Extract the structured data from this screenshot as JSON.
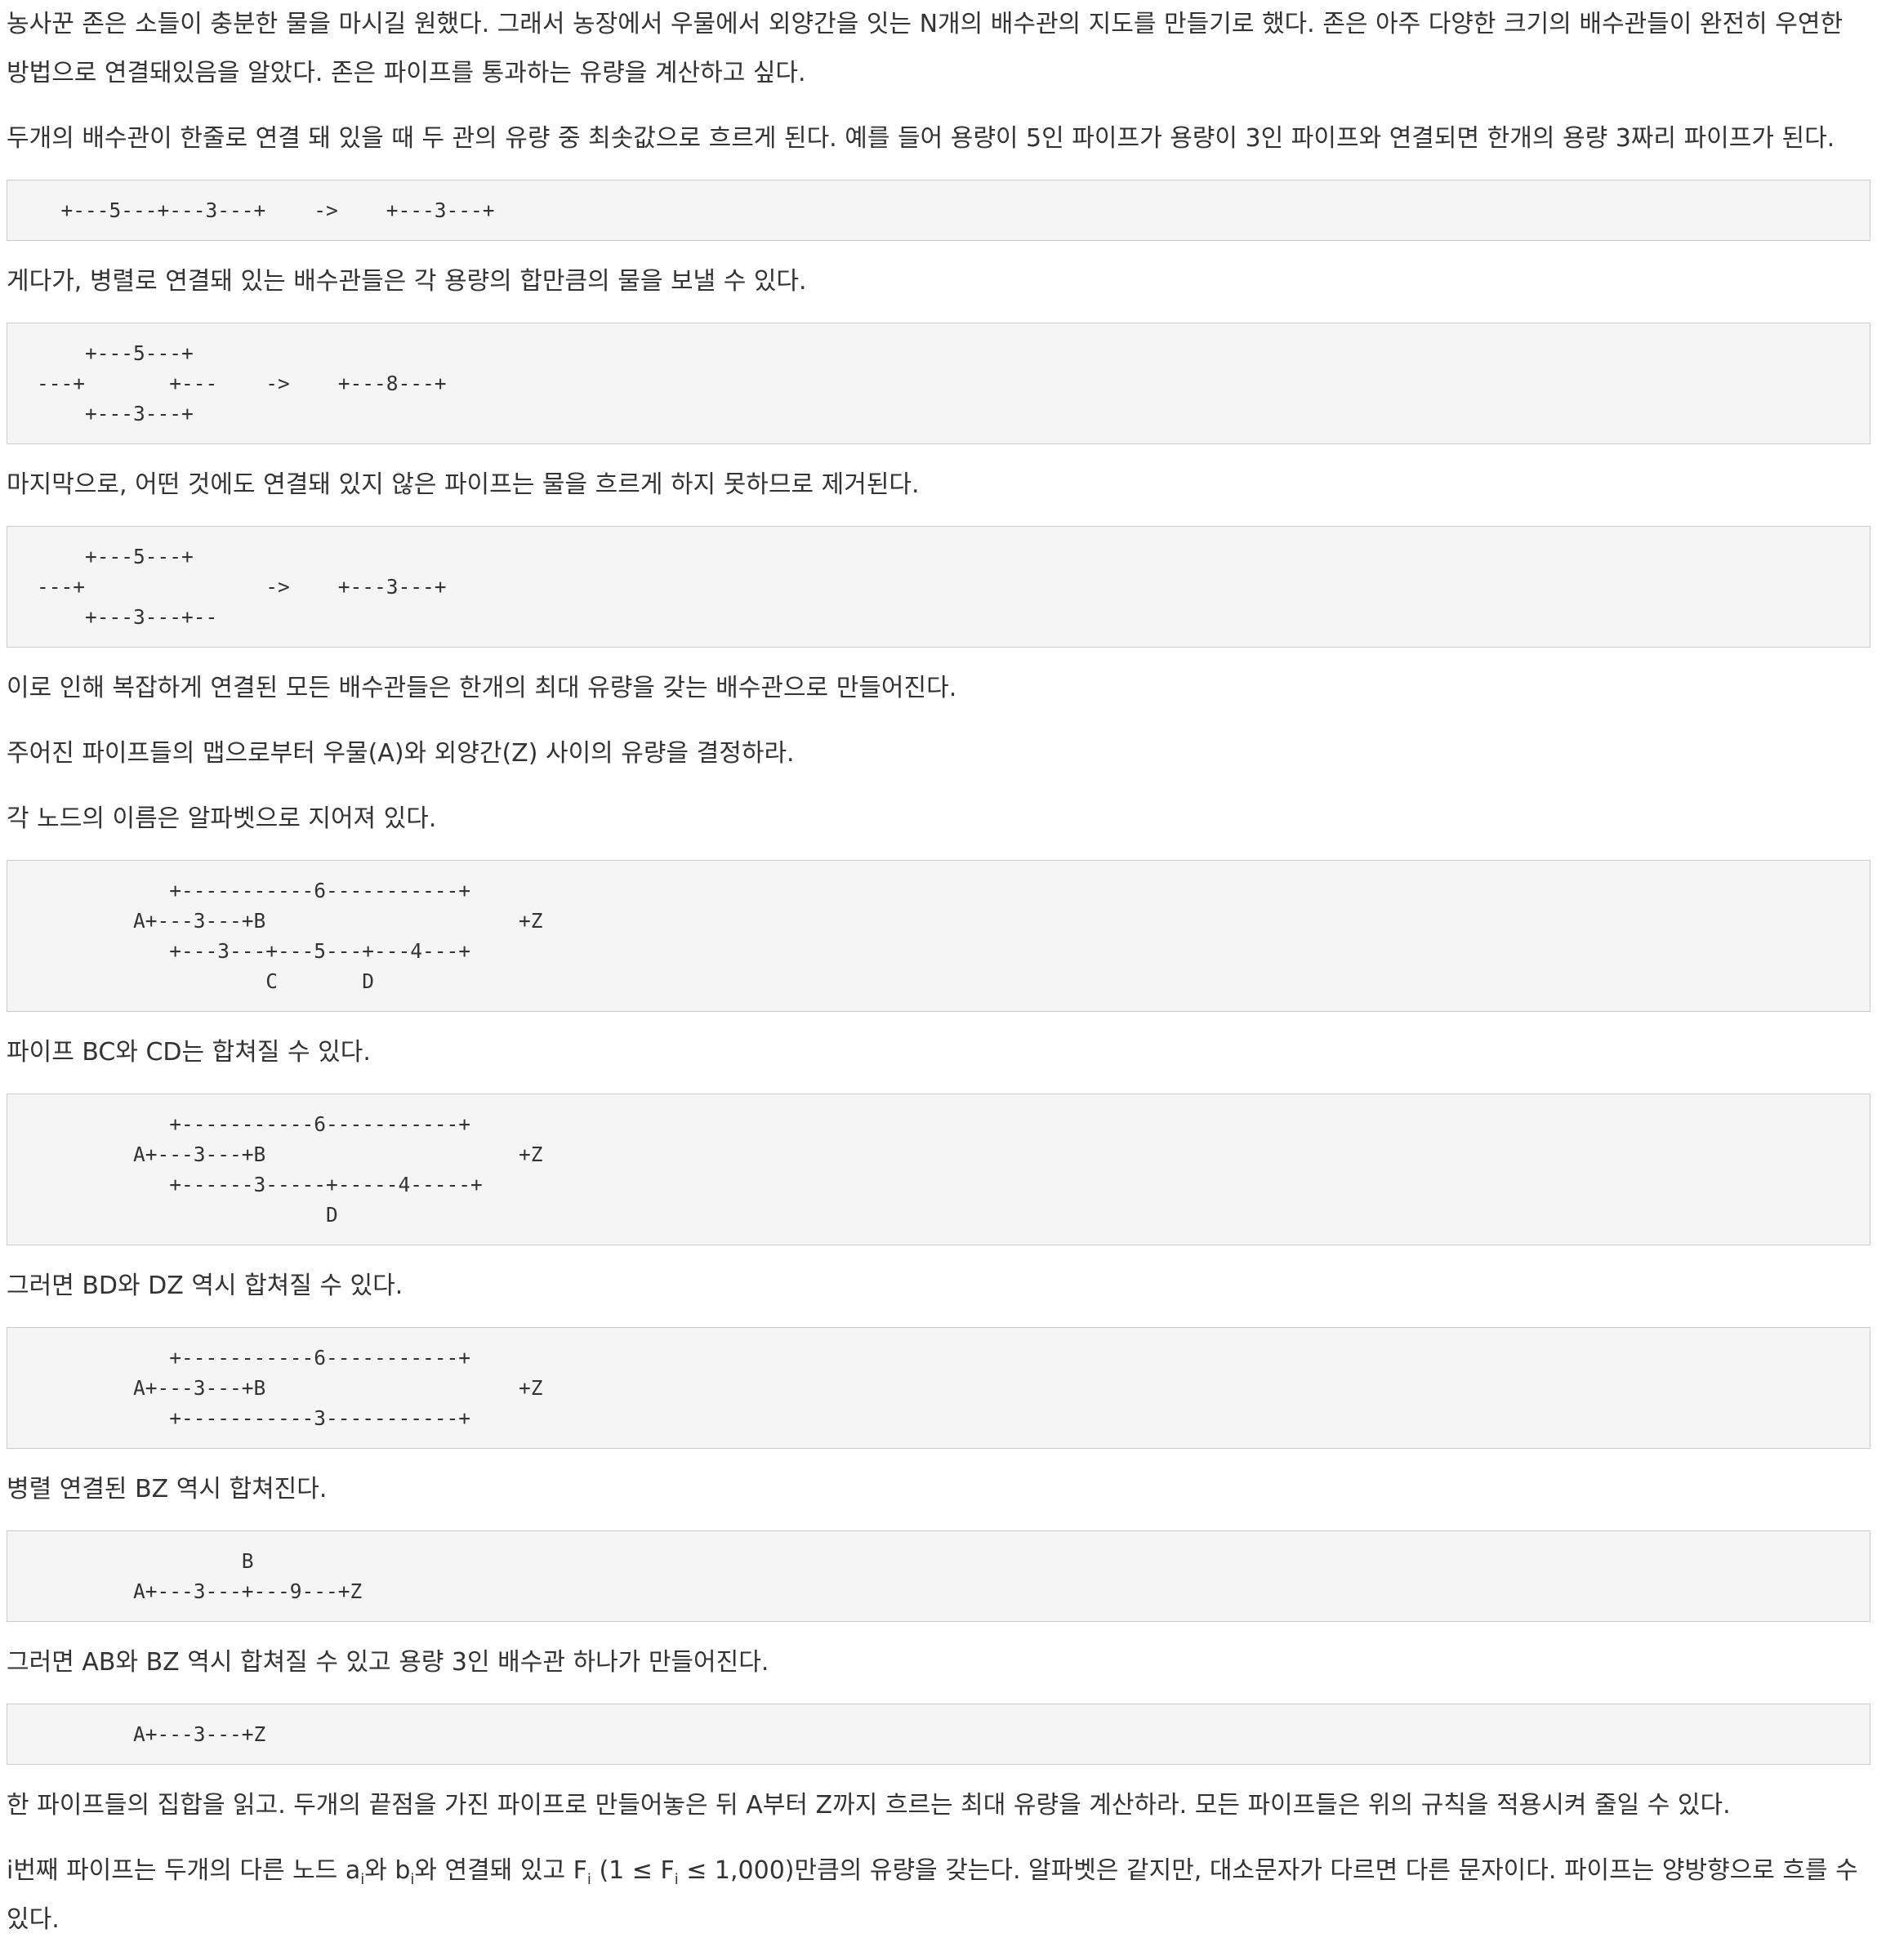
{
  "paragraphs": [
    "농사꾼 존은 소들이 충분한 물을 마시길 원했다. 그래서 농장에서 우물에서 외양간을 잇는 N개의 배수관의 지도를 만들기로 했다. 존은 아주 다양한 크기의 배수관들이 완전히 우연한 방법으로 연결돼있음을 알았다. 존은 파이프를 통과하는 유량을 계산하고 싶다.",
    "두개의 배수관이 한줄로 연결 돼 있을 때 두 관의 유량 중 최솟값으로 흐르게 된다. 예를 들어 용량이 5인 파이프가 용량이 3인 파이프와 연결되면 한개의 용량 3짜리 파이프가 된다.",
    "게다가, 병렬로 연결돼 있는 배수관들은 각 용량의 합만큼의 물을 보낼 수 있다.",
    "마지막으로, 어떤 것에도 연결돼 있지 않은 파이프는 물을 흐르게 하지 못하므로 제거된다.",
    "이로 인해 복잡하게 연결된 모든 배수관들은 한개의 최대 유량을 갖는 배수관으로 만들어진다.",
    "주어진 파이프들의 맵으로부터 우물(A)와 외양간(Z) 사이의 유량을 결정하라.",
    "각 노드의 이름은 알파벳으로 지어져 있다.",
    "파이프 BC와 CD는 합쳐질 수 있다.",
    "그러면 BD와 DZ 역시 합쳐질 수 있다.",
    "병렬 연결된 BZ 역시 합쳐진다.",
    "그러면 AB와 BZ 역시 합쳐질 수 있고 용량 3인 배수관 하나가 만들어진다.",
    "한 파이프들의 집합을 읽고. 두개의 끝점을 가진 파이프로 만들어놓은 뒤 A부터 Z까지 흐르는 최대 유량을 계산하라. 모든 파이프들은 위의 규칙을 적용시켜 줄일 수 있다."
  ],
  "last_paragraph": {
    "t1": "i번째 파이프는 두개의 다른 노드 a",
    "s1": "i",
    "t2": "와 b",
    "s2": "i",
    "t3": "와 연결돼 있고 F",
    "s3": "i",
    "t4": " (1 ≤ F",
    "s4": "i",
    "t5": " ≤ 1,000)만큼의 유량을 갖는다. 알파벳은 같지만, 대소문자가 다르면 다른 문자이다. 파이프는 양방향으로 흐를 수 있다."
  },
  "code_blocks": [
    "  +---5---+---3---+    ->    +---3---+",
    "    +---5---+\n---+       +---    ->    +---8---+\n    +---3---+",
    "    +---5---+\n---+               ->    +---3---+\n    +---3---+--",
    "           +-----------6-----------+\n        A+---3---+B                     +Z\n           +---3---+---5---+---4---+\n                   C       D",
    "           +-----------6-----------+\n        A+---3---+B                     +Z\n           +------3-----+-----4-----+\n                        D",
    "           +-----------6-----------+\n        A+---3---+B                     +Z\n           +-----------3-----------+",
    "                 B\n        A+---3---+---9---+Z",
    "        A+---3---+Z"
  ]
}
